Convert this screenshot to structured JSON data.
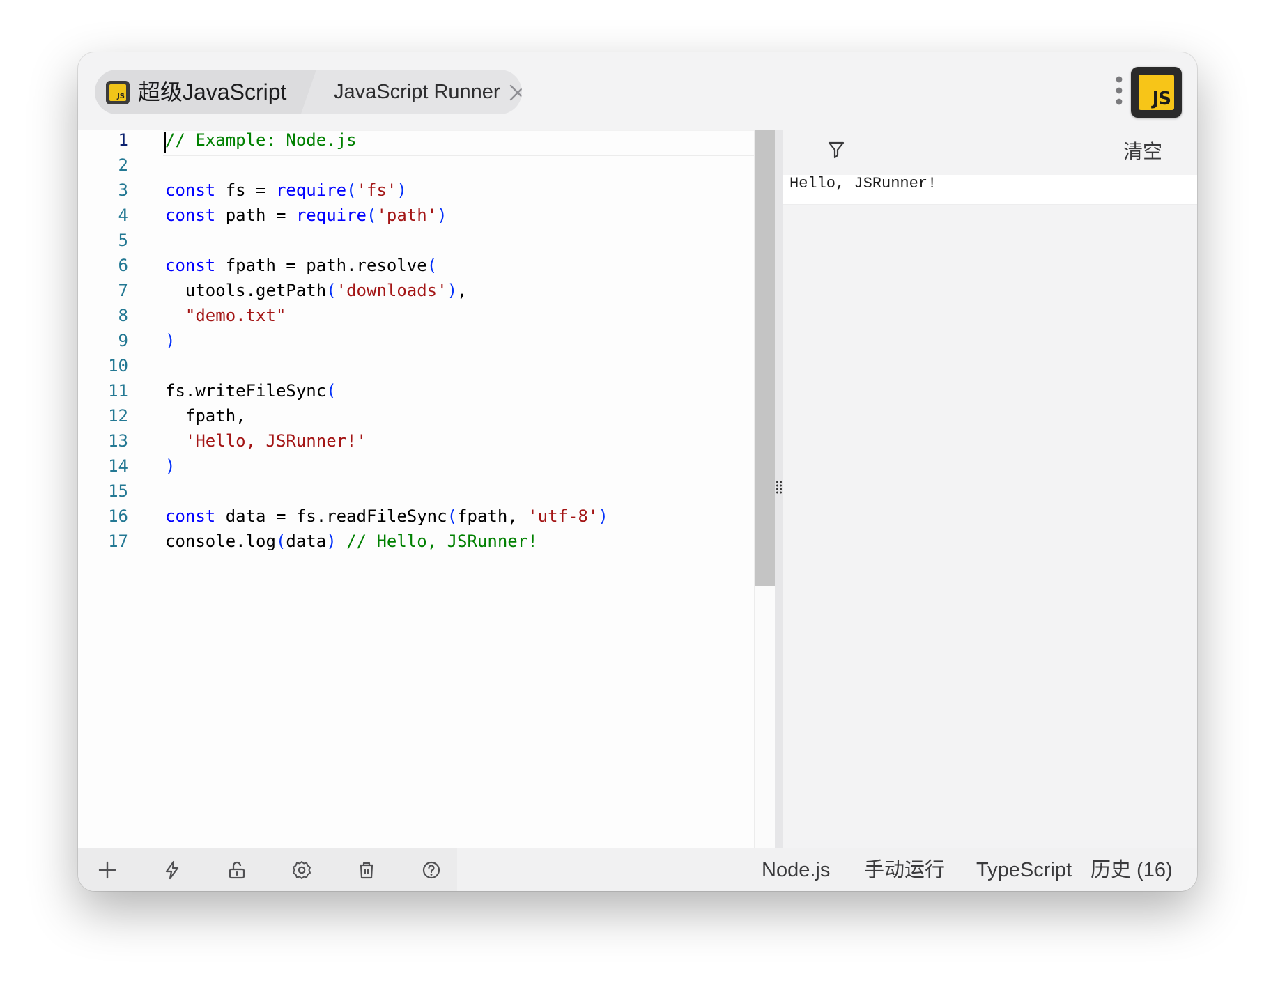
{
  "titlebar": {
    "plugin_tab": {
      "icon": "js-logo-icon",
      "label": "超级JavaScript"
    },
    "runner_tab": {
      "label": "JavaScript Runner",
      "close_icon": "close-icon"
    },
    "more_icon": "more-vertical-icon",
    "app_logo": {
      "text": "JS"
    }
  },
  "editor": {
    "line_numbers": [
      "1",
      "2",
      "3",
      "4",
      "5",
      "6",
      "7",
      "8",
      "9",
      "10",
      "11",
      "12",
      "13",
      "14",
      "15",
      "16",
      "17"
    ],
    "lines": [
      [
        {
          "t": "// Example: Node.js",
          "c": "com"
        }
      ],
      [],
      [
        {
          "t": "const",
          "c": "kw"
        },
        {
          "t": " fs = "
        },
        {
          "t": "require",
          "c": "fn sq"
        },
        {
          "t": "(",
          "c": "bracket"
        },
        {
          "t": "'fs'",
          "c": "str"
        },
        {
          "t": ")",
          "c": "bracket"
        }
      ],
      [
        {
          "t": "const",
          "c": "kw"
        },
        {
          "t": " path = "
        },
        {
          "t": "require",
          "c": "fn sq"
        },
        {
          "t": "(",
          "c": "bracket"
        },
        {
          "t": "'path'",
          "c": "str"
        },
        {
          "t": ")",
          "c": "bracket"
        }
      ],
      [],
      [
        {
          "t": "const",
          "c": "kw"
        },
        {
          "t": " fpath = path.resolve"
        },
        {
          "t": "(",
          "c": "bracket"
        }
      ],
      [
        {
          "t": "  utools.getPath"
        },
        {
          "t": "(",
          "c": "bracket"
        },
        {
          "t": "'downloads'",
          "c": "str"
        },
        {
          "t": ")",
          "c": "bracket"
        },
        {
          "t": ","
        }
      ],
      [
        {
          "t": "  "
        },
        {
          "t": "\"demo.txt\"",
          "c": "str"
        }
      ],
      [
        {
          "t": ")",
          "c": "bracket"
        }
      ],
      [],
      [
        {
          "t": "fs.writeFileSync"
        },
        {
          "t": "(",
          "c": "bracket"
        }
      ],
      [
        {
          "t": "  fpath,"
        }
      ],
      [
        {
          "t": "  "
        },
        {
          "t": "'Hello, JSRunner!'",
          "c": "str"
        }
      ],
      [
        {
          "t": ")",
          "c": "bracket"
        }
      ],
      [],
      [
        {
          "t": "const",
          "c": "kw"
        },
        {
          "t": " data = fs.readFileSync"
        },
        {
          "t": "(",
          "c": "bracket"
        },
        {
          "t": "fpath, "
        },
        {
          "t": "'utf-8'",
          "c": "str"
        },
        {
          "t": ")",
          "c": "bracket"
        }
      ],
      [
        {
          "t": "console.log"
        },
        {
          "t": "(",
          "c": "bracket"
        },
        {
          "t": "data"
        },
        {
          "t": ")",
          "c": "bracket"
        },
        {
          "t": " "
        },
        {
          "t": "// Hello, JSRunner!",
          "c": "com"
        }
      ]
    ],
    "active_line": 1
  },
  "output": {
    "filter_icon": "filter-icon",
    "clear_label": "清空",
    "logs": [
      "Hello, JSRunner!"
    ]
  },
  "toolbar": {
    "icons": [
      "plus-icon",
      "lightning-icon",
      "unlock-icon",
      "gear-icon",
      "trash-icon",
      "help-icon"
    ],
    "env_label": "Node.js",
    "run_mode_label": "手动运行",
    "language_label": "TypeScript",
    "history_label": "历史 (16)"
  }
}
